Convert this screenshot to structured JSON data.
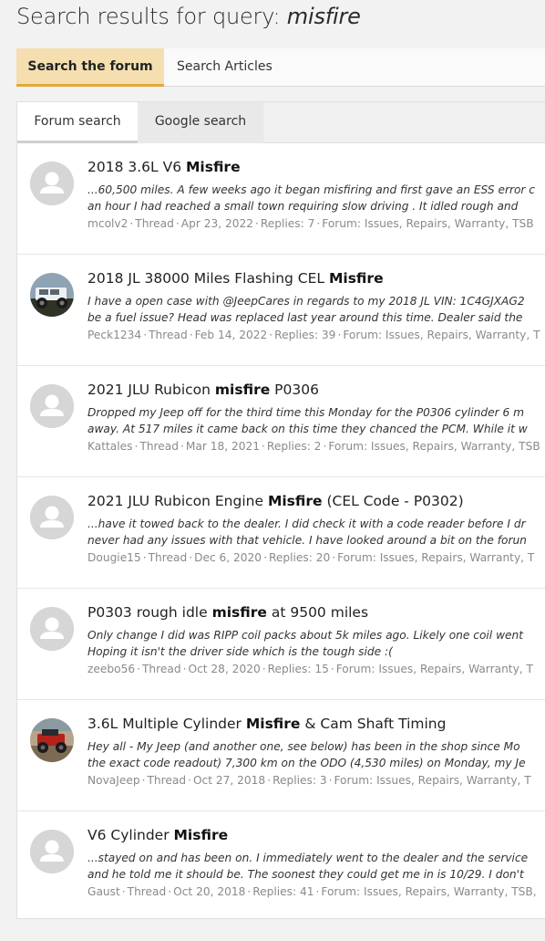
{
  "header": {
    "title_prefix": "Search results for query: ",
    "query": "misfire"
  },
  "primary_tabs": [
    {
      "label": "Search the forum",
      "active": true
    },
    {
      "label": "Search Articles",
      "active": false
    }
  ],
  "secondary_tabs": [
    {
      "label": "Forum search",
      "active": true
    },
    {
      "label": "Google search",
      "active": false
    }
  ],
  "colors": {
    "active_tab_bg": "#f5dfb1",
    "active_tab_underline": "#e2a93b",
    "default_avatar": "#d6d6d6"
  },
  "results": [
    {
      "avatar": "default-avatar",
      "title_pre": "2018 3.6L V6 ",
      "title_bold": "Misfire",
      "title_post": "",
      "snippet_1": "...60,500 miles. A few weeks ago it began misfiring and first gave an ESS error c",
      "snippet_2": "an hour I had reached a small town requiring slow driving . It idled rough and",
      "author": "mcolv2",
      "type": "Thread",
      "date": "Apr 23, 2022",
      "replies": "Replies: 7",
      "forum": "Forum: Issues, Repairs, Warranty, TSB"
    },
    {
      "avatar": "jeep-photo-white",
      "title_pre": "2018 JL 38000 Miles Flashing CEL ",
      "title_bold": "Misfire",
      "title_post": "",
      "snippet_1": "I have a open case with @JeepCares in regards to my 2018 JL VIN: 1C4GJXAG2",
      "snippet_2": "be a fuel issue? Head was replaced last year around this time. Dealer said the",
      "author": "Peck1234",
      "type": "Thread",
      "date": "Feb 14, 2022",
      "replies": "Replies: 39",
      "forum": "Forum: Issues, Repairs, Warranty, T"
    },
    {
      "avatar": "default-avatar",
      "title_pre": "2021 JLU Rubicon ",
      "title_bold": "misfire",
      "title_post": " P0306",
      "snippet_1": "Dropped my Jeep off for the third time this Monday for the P0306 cylinder 6 m",
      "snippet_2": "away. At 517 miles it came back on this time they chanced the PCM. While it w",
      "author": "Kattales",
      "type": "Thread",
      "date": "Mar 18, 2021",
      "replies": "Replies: 2",
      "forum": "Forum: Issues, Repairs, Warranty, TSB"
    },
    {
      "avatar": "default-avatar",
      "title_pre": "2021 JLU Rubicon Engine ",
      "title_bold": "Misfire",
      "title_post": " (CEL Code - P0302)",
      "snippet_1": "...have it towed back to the dealer. I did check it with a code reader before I dr",
      "snippet_2": "never had any issues with that vehicle. I have looked around a bit on the forun",
      "author": "Dougie15",
      "type": "Thread",
      "date": "Dec 6, 2020",
      "replies": "Replies: 20",
      "forum": "Forum: Issues, Repairs, Warranty, T"
    },
    {
      "avatar": "default-avatar",
      "title_pre": "P0303 rough idle ",
      "title_bold": "misfire",
      "title_post": " at 9500 miles",
      "snippet_1": "Only change I did was RIPP coil packs about 5k miles ago. Likely one coil went",
      "snippet_2": "Hoping it isn't the driver side which is the tough side :(",
      "author": "zeebo56",
      "type": "Thread",
      "date": "Oct 28, 2020",
      "replies": "Replies: 15",
      "forum": "Forum: Issues, Repairs, Warranty, T"
    },
    {
      "avatar": "jeep-photo-red",
      "title_pre": "3.6L Multiple Cylinder ",
      "title_bold": "Misfire",
      "title_post": " & Cam Shaft Timing",
      "snippet_1": "Hey all - My Jeep (and another one, see below) has been in the shop since Mo",
      "snippet_2": "the exact code readout) 7,300 km on the ODO (4,530 miles) on Monday, my Je",
      "author": "NovaJeep",
      "type": "Thread",
      "date": "Oct 27, 2018",
      "replies": "Replies: 3",
      "forum": "Forum: Issues, Repairs, Warranty, T"
    },
    {
      "avatar": "default-avatar",
      "title_pre": "V6 Cylinder ",
      "title_bold": "Misfire",
      "title_post": "",
      "snippet_1": "...stayed on and has been on. I immediately went to the dealer and the service",
      "snippet_2": "and he told me it should be. The soonest they could get me in is 10/29. I don't",
      "author": "Gaust",
      "type": "Thread",
      "date": "Oct 20, 2018",
      "replies": "Replies: 41",
      "forum": "Forum: Issues, Repairs, Warranty, TSB,"
    }
  ]
}
